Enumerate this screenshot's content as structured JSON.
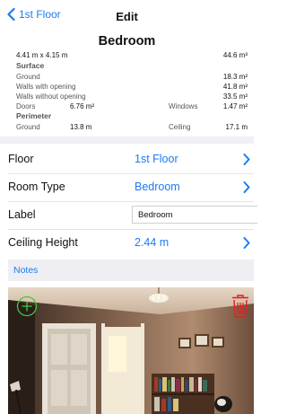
{
  "nav": {
    "back_label": "1st Floor",
    "title": "Edit"
  },
  "room": {
    "name": "Bedroom"
  },
  "stats": {
    "dimensions": "4.41 m x 4.15 m",
    "volume": "44.6 m³",
    "surface_heading": "Surface",
    "ground_label": "Ground",
    "ground_value": "18.3 m²",
    "walls_with_opening_label": "Walls with opening",
    "walls_with_opening_value": "41.8 m²",
    "walls_without_opening_label": "Walls without opening",
    "walls_without_opening_value": "33.5 m²",
    "doors_label": "Doors",
    "doors_value": "6.76 m²",
    "windows_label": "Windows",
    "windows_value": "1.47 m²",
    "perimeter_heading": "Perimeter",
    "perimeter_ground_label": "Ground",
    "perimeter_ground_value": "13.8 m",
    "ceiling_label": "Ceiling",
    "ceiling_value": "17.1 m"
  },
  "form": {
    "floor_label": "Floor",
    "floor_value": "1st Floor",
    "room_type_label": "Room Type",
    "room_type_value": "Bedroom",
    "label_label": "Label",
    "label_value": "Bedroom",
    "ceiling_height_label": "Ceiling Height",
    "ceiling_height_value": "2.44 m"
  },
  "notes": {
    "label": "Notes"
  },
  "colors": {
    "accent": "#1a7cf5",
    "add": "#3ec93e",
    "delete": "#e02020"
  },
  "icons": {
    "back": "chevron-left-icon",
    "disclosure": "chevron-right-icon",
    "add_photo": "plus-circle-icon",
    "delete_photo": "trash-icon"
  }
}
